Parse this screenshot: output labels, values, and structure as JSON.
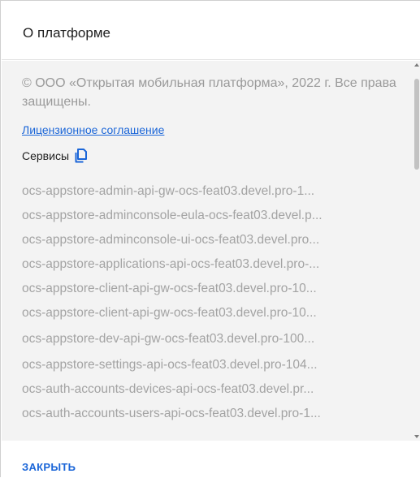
{
  "dialog": {
    "title": "О платформе",
    "copyright": "© ООО «Открытая мобильная платформа», 2022 г. Все права защищены.",
    "license_link": "Лицензионное соглашение",
    "services_label": "Сервисы",
    "services": [
      "ocs-appstore-admin-api-gw-ocs-feat03.devel.pro-1...",
      "ocs-appstore-adminconsole-eula-ocs-feat03.devel.p...",
      "ocs-appstore-adminconsole-ui-ocs-feat03.devel.pro...",
      "ocs-appstore-applications-api-ocs-feat03.devel.pro-...",
      "ocs-appstore-client-api-gw-ocs-feat03.devel.pro-10...",
      "ocs-appstore-client-api-gw-ocs-feat03.devel.pro-10...",
      "ocs-appstore-dev-api-gw-ocs-feat03.devel.pro-100...",
      "ocs-appstore-settings-api-ocs-feat03.devel.pro-104...",
      "ocs-auth-accounts-devices-api-ocs-feat03.devel.pr...",
      "ocs-auth-accounts-users-api-ocs-feat03.devel.pro-1..."
    ],
    "close_label": "ЗАКРЫТЬ"
  },
  "icons": {
    "copy": "copy-icon"
  },
  "colors": {
    "accent": "#1b66d8",
    "muted_text": "#a3a3a3",
    "body_bg": "#f3f3f3"
  }
}
